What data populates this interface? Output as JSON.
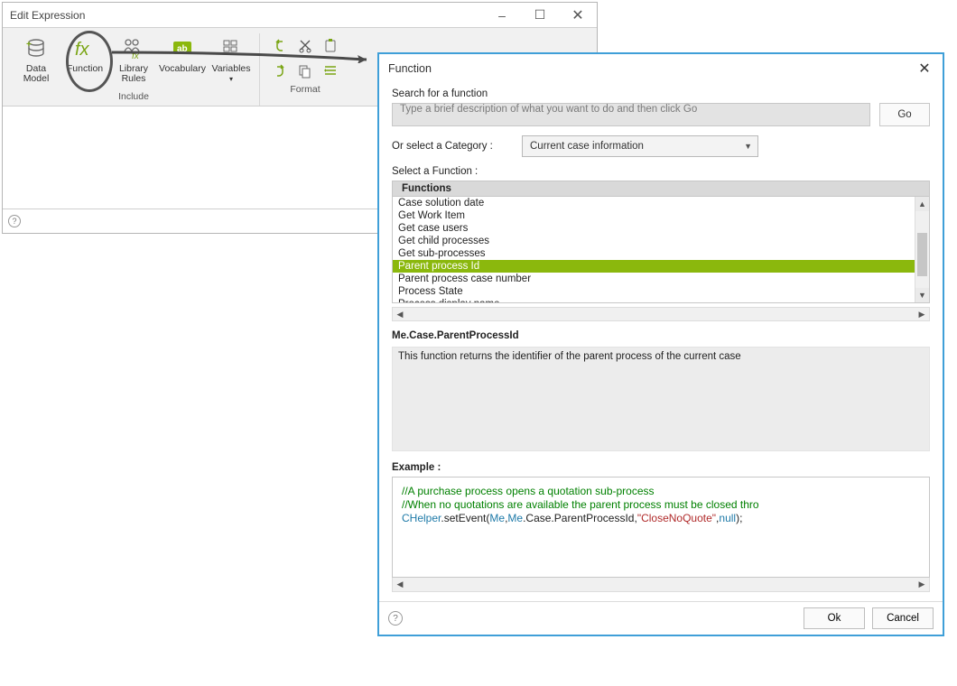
{
  "edit_window": {
    "title": "Edit Expression",
    "ribbon": {
      "groups": {
        "include": {
          "caption": "Include",
          "items": {
            "data_model": "Data\nModel",
            "function": "Function",
            "library_rules": "Library\nRules",
            "vocabulary": "Vocabulary",
            "variables": "Variables"
          }
        },
        "format": {
          "caption": "Format"
        }
      }
    }
  },
  "function_dialog": {
    "title": "Function",
    "search_label": "Search for a function",
    "search_placeholder": "Type a brief description of what you want to do and then click Go",
    "go_label": "Go",
    "category_label": "Or select a Category :",
    "category_value": "Current case information",
    "select_label": "Select a Function :",
    "list_header": "Functions",
    "functions": [
      "Case solution date",
      "Get Work Item",
      "Get case users",
      "Get child processes",
      "Get sub-processes",
      "Parent process Id",
      "Parent process case number",
      "Process State",
      "Process display name"
    ],
    "selected_index": 5,
    "signature": "Me.Case.ParentProcessId",
    "description": "This function returns the identifier of the parent process of the current case",
    "example_label": "Example :",
    "example_code": {
      "comment1": "//A purchase process opens a quotation sub-process",
      "comment2": "//When no quotations are available the parent process must be closed thro",
      "line3_parts": {
        "a": "CHelper",
        "b": ".setEvent(",
        "c": "Me",
        "d": ",",
        "e": "Me",
        "f": ".Case.ParentProcessId,",
        "g": "\"CloseNoQuote\"",
        "h": ",",
        "i": "null",
        "j": ");"
      }
    },
    "ok_label": "Ok",
    "cancel_label": "Cancel"
  }
}
